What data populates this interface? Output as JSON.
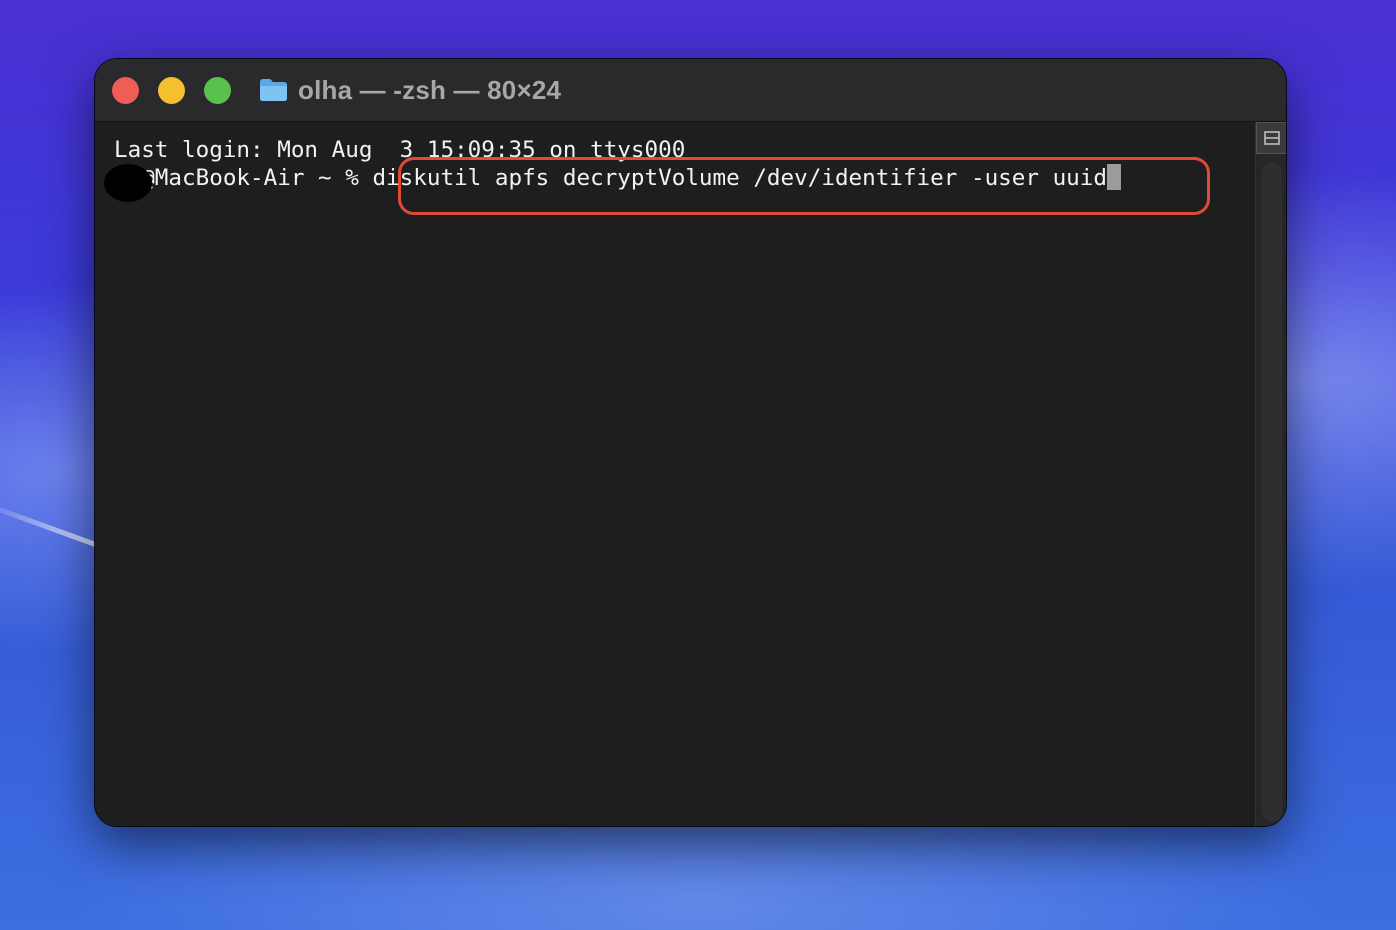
{
  "window": {
    "title": "olha — -zsh — 80×24",
    "folder_icon": "folder-icon"
  },
  "traffic_lights": {
    "close_color": "#ee5d56",
    "minimize_color": "#f4c030",
    "maximize_color": "#5bc14d"
  },
  "terminal": {
    "last_login": "Last login: Mon Aug  3 15:09:35 on ttys000",
    "prompt": "ha@MacBook-Air ~ % ",
    "command": "diskutil apfs decryptVolume /dev/identifier -user uuid"
  },
  "annotation": {
    "highlight_color": "#e04a36"
  }
}
